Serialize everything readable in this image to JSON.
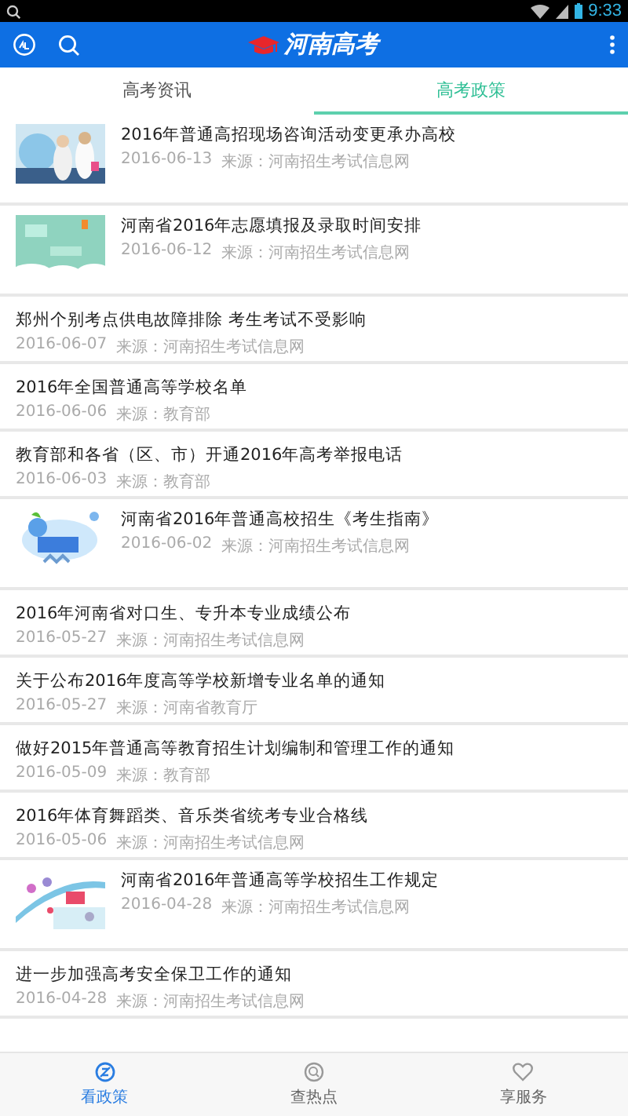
{
  "status_bar": {
    "time": "9:33"
  },
  "header": {
    "title": "河南高考"
  },
  "tabs": [
    {
      "label": "高考资讯",
      "selected": false
    },
    {
      "label": "高考政策",
      "selected": true
    }
  ],
  "articles": [
    {
      "title": "2016年普通高招现场咨询活动变更承办高校",
      "date": "2016-06-13",
      "source": "来源：河南招生考试信息网"
    },
    {
      "title": "河南省2016年志愿填报及录取时间安排",
      "date": "2016-06-12",
      "source": "来源：河南招生考试信息网"
    },
    {
      "kind": "text",
      "title": "郑州个别考点供电故障排除 考生考试不受影响",
      "date": "2016-06-07",
      "source": "来源：河南招生考试信息网"
    },
    {
      "kind": "text",
      "title": "2016年全国普通高等学校名单",
      "date": "2016-06-06",
      "source": "来源：教育部"
    },
    {
      "kind": "text",
      "title": "教育部和各省（区、市）开通2016年高考举报电话",
      "date": "2016-06-03",
      "source": "来源：教育部"
    },
    {
      "title": "河南省2016年普通高校招生《考生指南》",
      "date": "2016-06-02",
      "source": "来源：河南招生考试信息网"
    },
    {
      "kind": "text",
      "title": "2016年河南省对口生、专升本专业成绩公布",
      "date": "2016-05-27",
      "source": "来源：河南招生考试信息网"
    },
    {
      "kind": "text",
      "title": "关于公布2016年度高等学校新增专业名单的通知",
      "date": "2016-05-27",
      "source": "来源：河南省教育厅"
    },
    {
      "kind": "text",
      "title": "做好2015年普通高等教育招生计划编制和管理工作的通知",
      "date": "2016-05-09",
      "source": "来源：教育部"
    },
    {
      "kind": "text",
      "title": "2016年体育舞蹈类、音乐类省统考专业合格线",
      "date": "2016-05-06",
      "source": "来源：河南招生考试信息网"
    },
    {
      "title": "河南省2016年普通高等学校招生工作规定",
      "date": "2016-04-28",
      "source": "来源：河南招生考试信息网"
    },
    {
      "kind": "text",
      "title": "进一步加强高考安全保卫工作的通知",
      "date": "2016-04-28",
      "source": "来源：河南招生考试信息网"
    }
  ],
  "bottom_nav": [
    {
      "label": "看政策",
      "selected": true
    },
    {
      "label": "查热点",
      "selected": false
    },
    {
      "label": "享服务",
      "selected": false
    }
  ]
}
